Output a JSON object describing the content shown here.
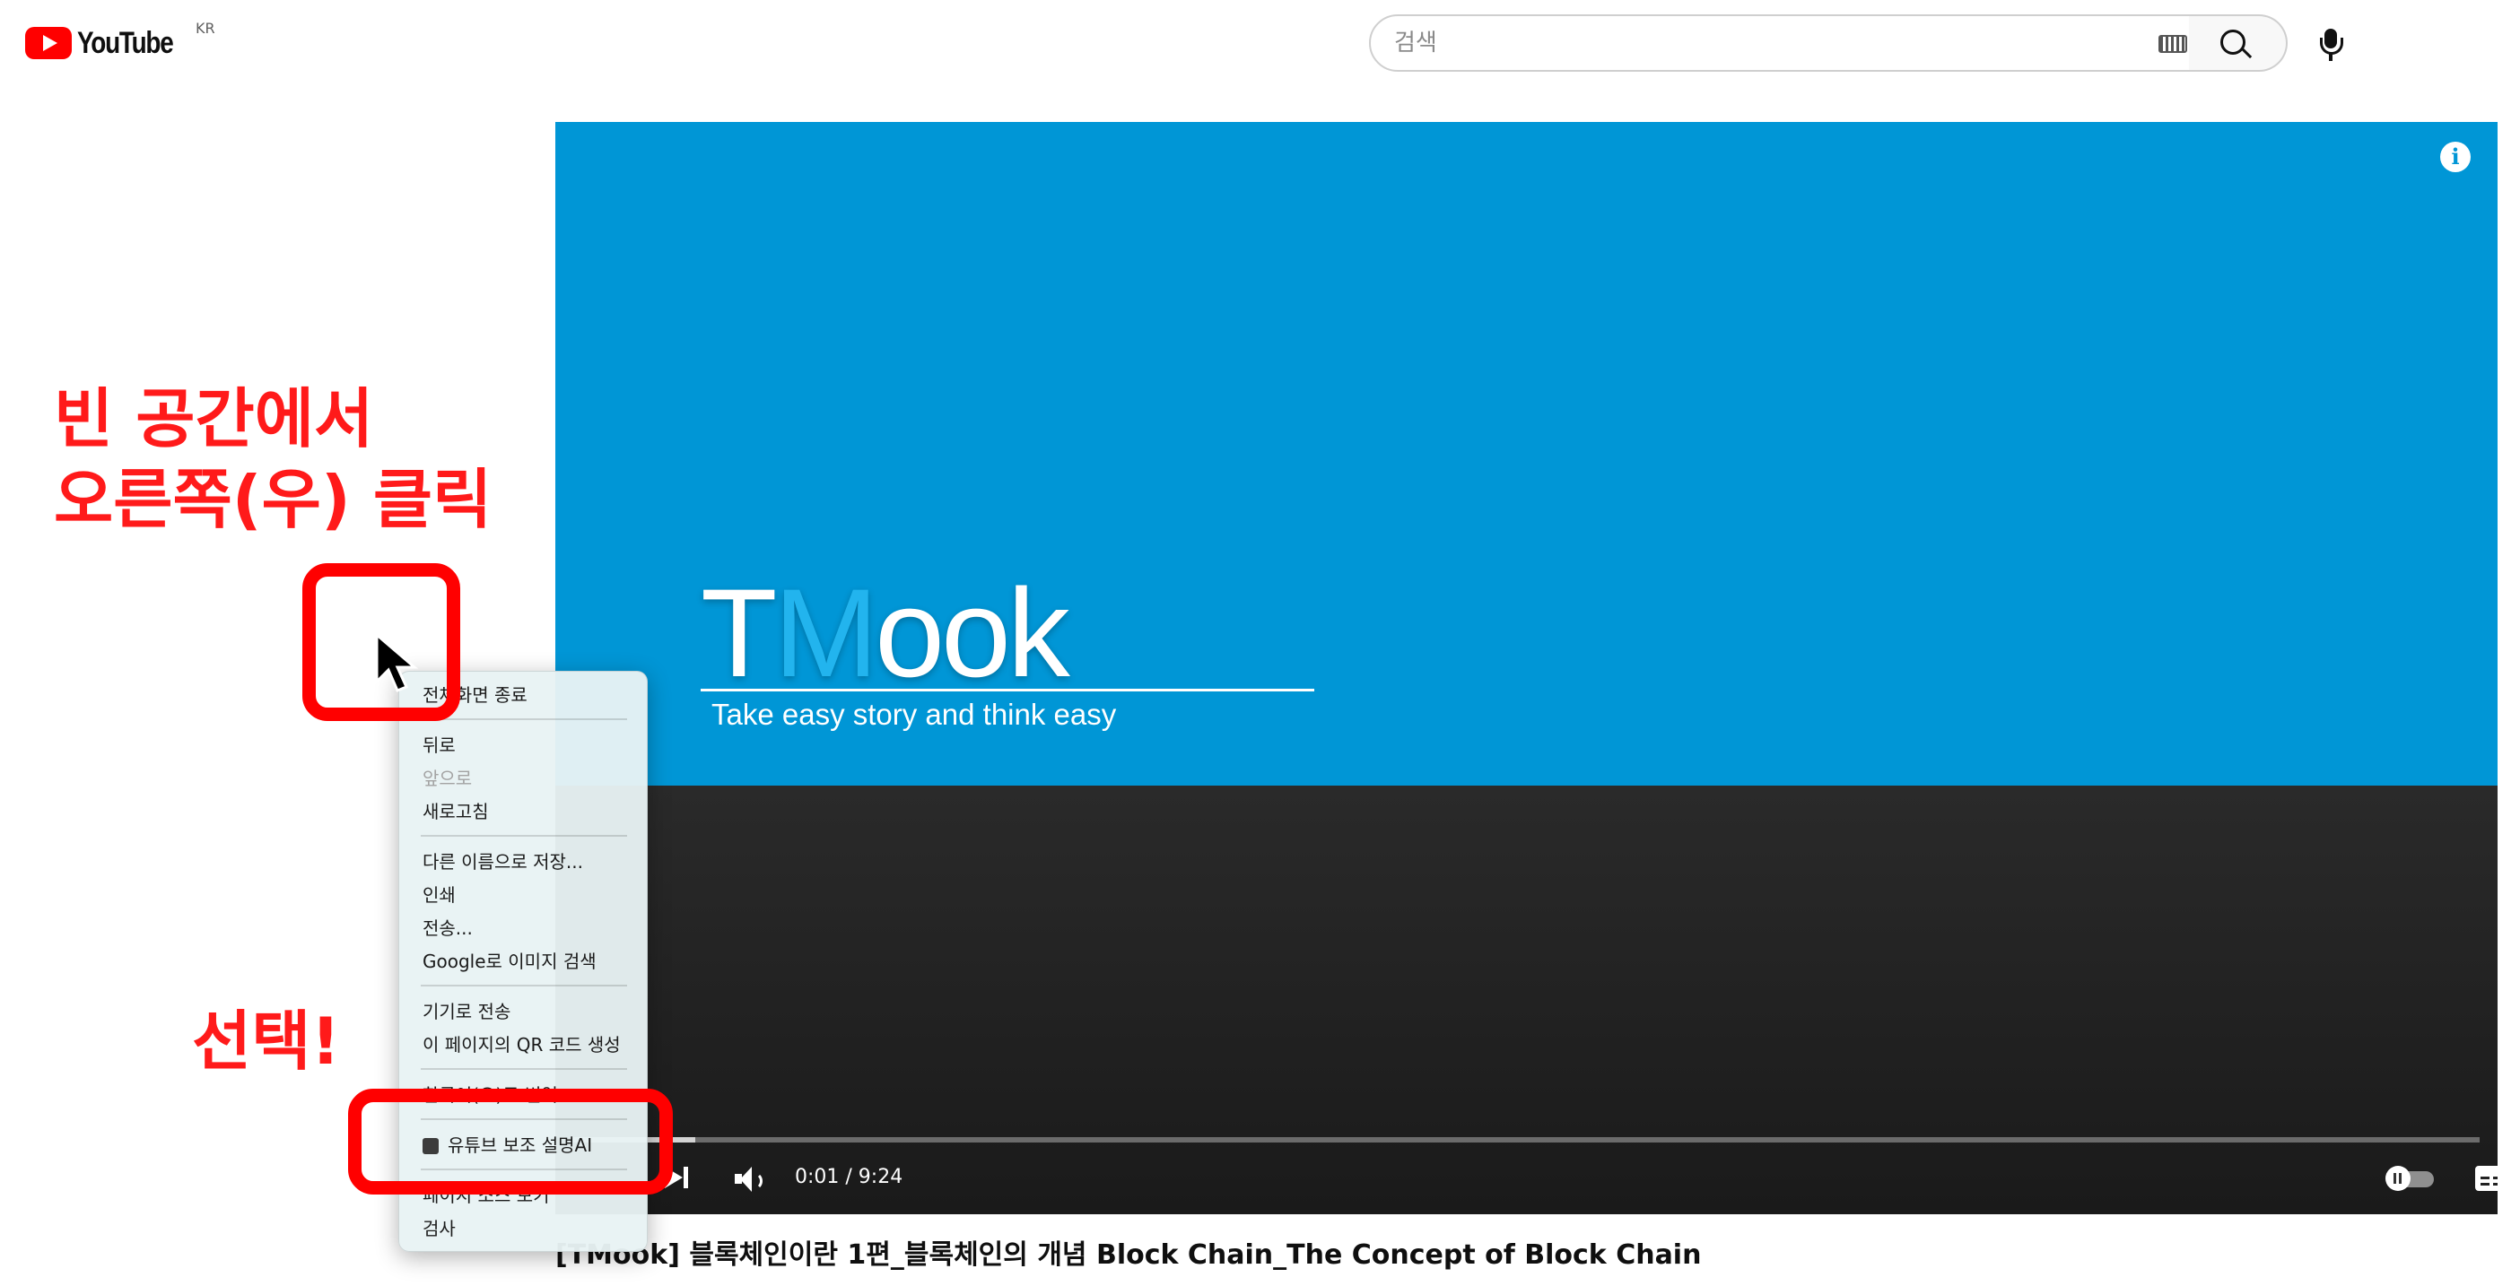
{
  "header": {
    "logo_text": "YouTube",
    "country_code": "KR",
    "search_placeholder": "검색"
  },
  "video": {
    "brand_text_t": "T",
    "brand_text_m": "M",
    "brand_text_rest": "ook",
    "tagline": "Take easy story and think easy",
    "time": "0:01 / 9:24",
    "progress": 0.064,
    "title": "[TMook] 블록체인이란 1편_블록체인의 개념 Block Chain_The Concept of Block Chain"
  },
  "context_menu": {
    "items": [
      "전체화면 종료",
      "뒤로",
      "앞으로",
      "새로고침",
      "다른 이름으로 저장...",
      "인쇄",
      "전송...",
      "Google로 이미지 검색",
      "기기로 전송",
      "이 페이지의 QR 코드 생성",
      "한국어(으)로 번역",
      "유튜브 보조 설명AI",
      "페이지 소스 보기",
      "검사"
    ]
  },
  "annotations": {
    "instruction_line1": "빈 공간에서",
    "instruction_line2": "오른쪽(우) 클릭",
    "select_label": "선택!",
    "accent_color": "#ff0000"
  },
  "colors": {
    "video_sky": "#0096d6",
    "youtube_red": "#ff0000"
  }
}
